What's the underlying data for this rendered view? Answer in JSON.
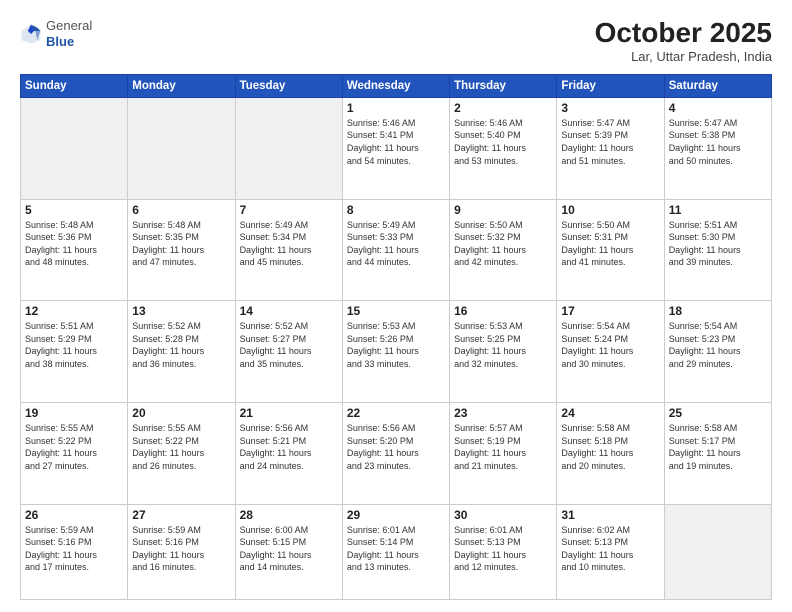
{
  "header": {
    "logo_line1": "General",
    "logo_line2": "Blue",
    "month": "October 2025",
    "location": "Lar, Uttar Pradesh, India"
  },
  "weekdays": [
    "Sunday",
    "Monday",
    "Tuesday",
    "Wednesday",
    "Thursday",
    "Friday",
    "Saturday"
  ],
  "weeks": [
    [
      {
        "day": "",
        "info": ""
      },
      {
        "day": "",
        "info": ""
      },
      {
        "day": "",
        "info": ""
      },
      {
        "day": "1",
        "info": "Sunrise: 5:46 AM\nSunset: 5:41 PM\nDaylight: 11 hours\nand 54 minutes."
      },
      {
        "day": "2",
        "info": "Sunrise: 5:46 AM\nSunset: 5:40 PM\nDaylight: 11 hours\nand 53 minutes."
      },
      {
        "day": "3",
        "info": "Sunrise: 5:47 AM\nSunset: 5:39 PM\nDaylight: 11 hours\nand 51 minutes."
      },
      {
        "day": "4",
        "info": "Sunrise: 5:47 AM\nSunset: 5:38 PM\nDaylight: 11 hours\nand 50 minutes."
      }
    ],
    [
      {
        "day": "5",
        "info": "Sunrise: 5:48 AM\nSunset: 5:36 PM\nDaylight: 11 hours\nand 48 minutes."
      },
      {
        "day": "6",
        "info": "Sunrise: 5:48 AM\nSunset: 5:35 PM\nDaylight: 11 hours\nand 47 minutes."
      },
      {
        "day": "7",
        "info": "Sunrise: 5:49 AM\nSunset: 5:34 PM\nDaylight: 11 hours\nand 45 minutes."
      },
      {
        "day": "8",
        "info": "Sunrise: 5:49 AM\nSunset: 5:33 PM\nDaylight: 11 hours\nand 44 minutes."
      },
      {
        "day": "9",
        "info": "Sunrise: 5:50 AM\nSunset: 5:32 PM\nDaylight: 11 hours\nand 42 minutes."
      },
      {
        "day": "10",
        "info": "Sunrise: 5:50 AM\nSunset: 5:31 PM\nDaylight: 11 hours\nand 41 minutes."
      },
      {
        "day": "11",
        "info": "Sunrise: 5:51 AM\nSunset: 5:30 PM\nDaylight: 11 hours\nand 39 minutes."
      }
    ],
    [
      {
        "day": "12",
        "info": "Sunrise: 5:51 AM\nSunset: 5:29 PM\nDaylight: 11 hours\nand 38 minutes."
      },
      {
        "day": "13",
        "info": "Sunrise: 5:52 AM\nSunset: 5:28 PM\nDaylight: 11 hours\nand 36 minutes."
      },
      {
        "day": "14",
        "info": "Sunrise: 5:52 AM\nSunset: 5:27 PM\nDaylight: 11 hours\nand 35 minutes."
      },
      {
        "day": "15",
        "info": "Sunrise: 5:53 AM\nSunset: 5:26 PM\nDaylight: 11 hours\nand 33 minutes."
      },
      {
        "day": "16",
        "info": "Sunrise: 5:53 AM\nSunset: 5:25 PM\nDaylight: 11 hours\nand 32 minutes."
      },
      {
        "day": "17",
        "info": "Sunrise: 5:54 AM\nSunset: 5:24 PM\nDaylight: 11 hours\nand 30 minutes."
      },
      {
        "day": "18",
        "info": "Sunrise: 5:54 AM\nSunset: 5:23 PM\nDaylight: 11 hours\nand 29 minutes."
      }
    ],
    [
      {
        "day": "19",
        "info": "Sunrise: 5:55 AM\nSunset: 5:22 PM\nDaylight: 11 hours\nand 27 minutes."
      },
      {
        "day": "20",
        "info": "Sunrise: 5:55 AM\nSunset: 5:22 PM\nDaylight: 11 hours\nand 26 minutes."
      },
      {
        "day": "21",
        "info": "Sunrise: 5:56 AM\nSunset: 5:21 PM\nDaylight: 11 hours\nand 24 minutes."
      },
      {
        "day": "22",
        "info": "Sunrise: 5:56 AM\nSunset: 5:20 PM\nDaylight: 11 hours\nand 23 minutes."
      },
      {
        "day": "23",
        "info": "Sunrise: 5:57 AM\nSunset: 5:19 PM\nDaylight: 11 hours\nand 21 minutes."
      },
      {
        "day": "24",
        "info": "Sunrise: 5:58 AM\nSunset: 5:18 PM\nDaylight: 11 hours\nand 20 minutes."
      },
      {
        "day": "25",
        "info": "Sunrise: 5:58 AM\nSunset: 5:17 PM\nDaylight: 11 hours\nand 19 minutes."
      }
    ],
    [
      {
        "day": "26",
        "info": "Sunrise: 5:59 AM\nSunset: 5:16 PM\nDaylight: 11 hours\nand 17 minutes."
      },
      {
        "day": "27",
        "info": "Sunrise: 5:59 AM\nSunset: 5:16 PM\nDaylight: 11 hours\nand 16 minutes."
      },
      {
        "day": "28",
        "info": "Sunrise: 6:00 AM\nSunset: 5:15 PM\nDaylight: 11 hours\nand 14 minutes."
      },
      {
        "day": "29",
        "info": "Sunrise: 6:01 AM\nSunset: 5:14 PM\nDaylight: 11 hours\nand 13 minutes."
      },
      {
        "day": "30",
        "info": "Sunrise: 6:01 AM\nSunset: 5:13 PM\nDaylight: 11 hours\nand 12 minutes."
      },
      {
        "day": "31",
        "info": "Sunrise: 6:02 AM\nSunset: 5:13 PM\nDaylight: 11 hours\nand 10 minutes."
      },
      {
        "day": "",
        "info": ""
      }
    ]
  ]
}
